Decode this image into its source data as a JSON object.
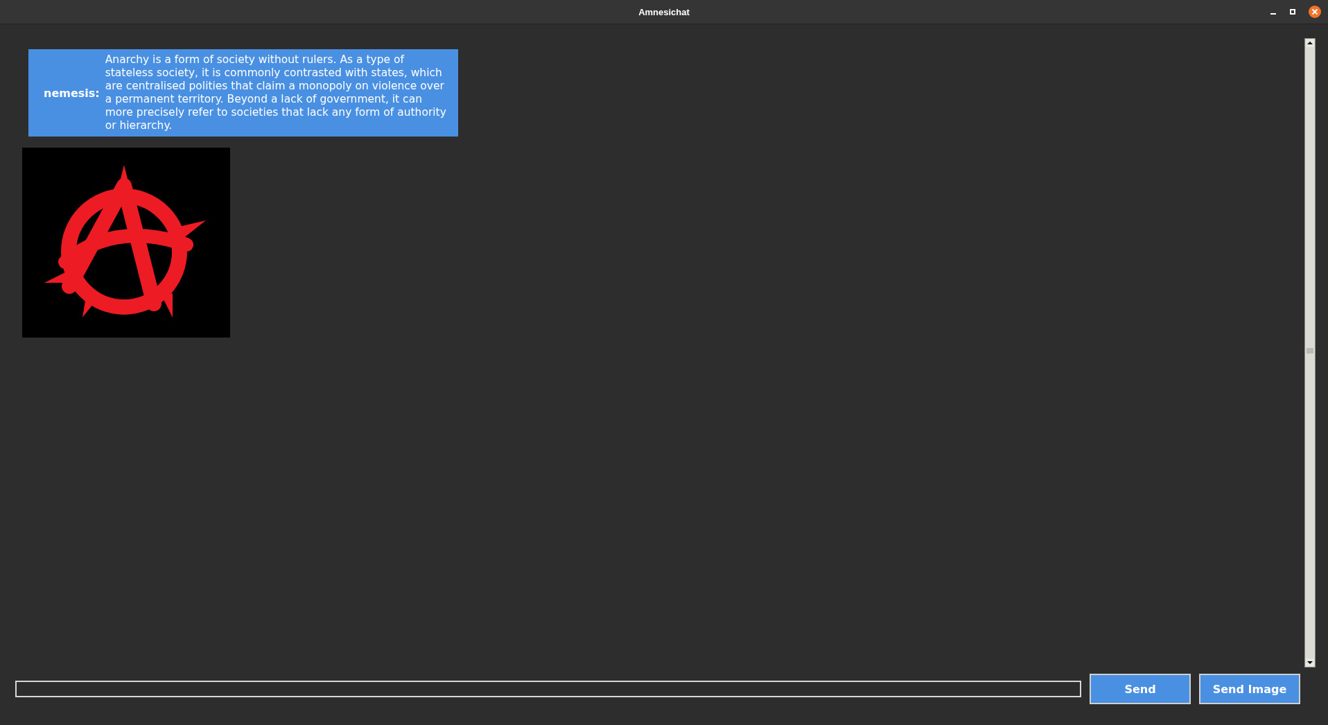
{
  "window": {
    "title": "Amnesichat"
  },
  "messages": [
    {
      "kind": "text",
      "sender": "nemesis:",
      "text": "Anarchy is a form of society without rulers. As a type of stateless society, it is commonly contrasted with states, which are centralised polities that claim a monopoly on violence over a permanent territory. Beyond a lack of government, it can more precisely refer to societies that lack any form of authority or hierarchy."
    },
    {
      "kind": "image"
    }
  ],
  "composer": {
    "buttons": [
      "Send",
      "Send Image"
    ]
  }
}
